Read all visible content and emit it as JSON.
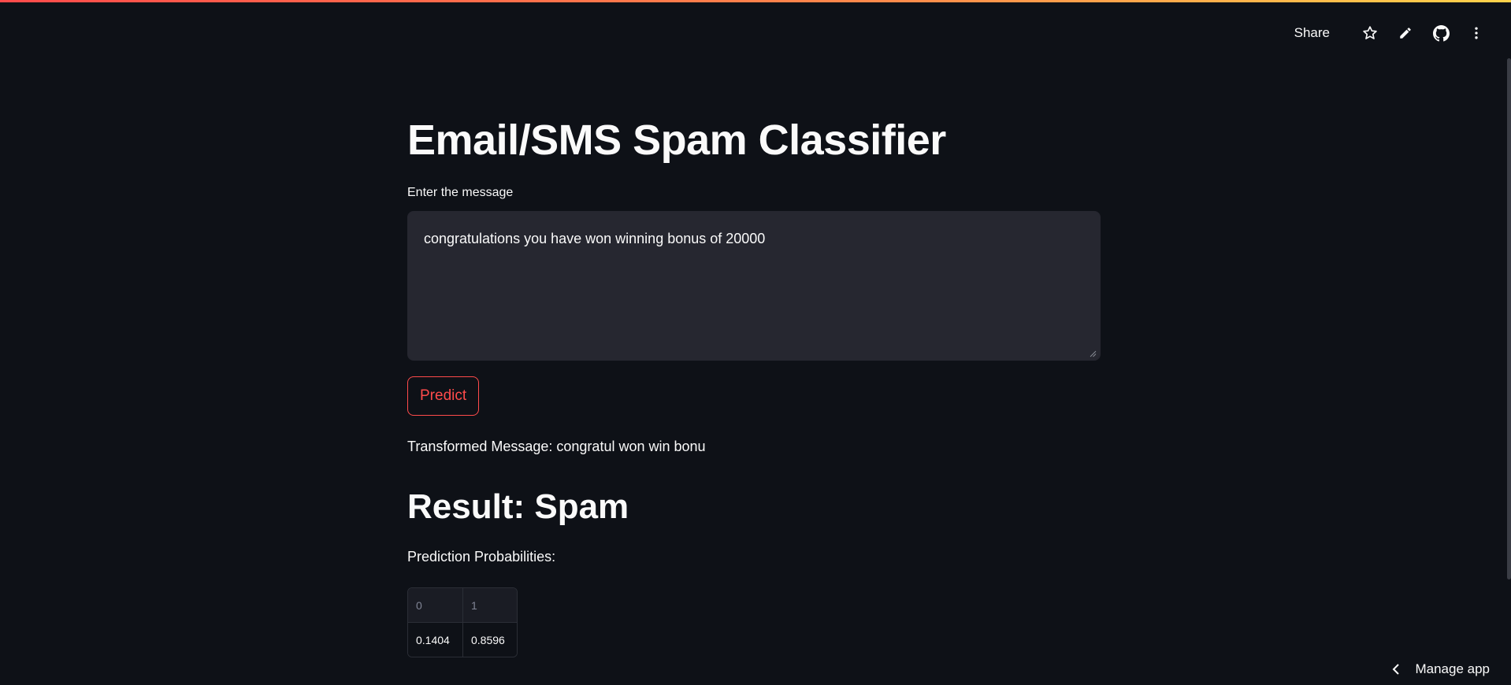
{
  "header": {
    "share_label": "Share"
  },
  "icons": {
    "star": "star-icon",
    "edit": "pencil-icon",
    "github": "github-icon",
    "menu": "kebab-menu-icon",
    "chevron": "chevron-left-icon"
  },
  "main": {
    "title": "Email/SMS Spam Classifier",
    "input_label": "Enter the message",
    "input_value": "congratulations you have won winning bonus of 20000",
    "predict_label": "Predict",
    "transformed_text": "Transformed Message: congratul won win bonu",
    "result_text": "Result: Spam",
    "probabilities_label": "Prediction Probabilities:",
    "table": {
      "columns": [
        "0",
        "1"
      ],
      "rows": [
        [
          "0.1404",
          "0.8596"
        ]
      ]
    }
  },
  "footer": {
    "manage_app_label": "Manage app"
  },
  "colors": {
    "background": "#0e1117",
    "accent": "#ff4b4b",
    "input_bg": "#262730"
  }
}
